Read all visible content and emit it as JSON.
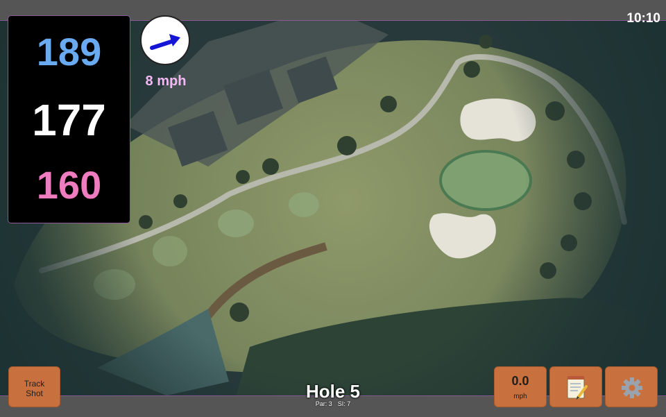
{
  "status_bar": {
    "time": "10:10"
  },
  "distances": {
    "back": "189",
    "middle": "177",
    "front": "160"
  },
  "colors": {
    "back": "#6aaaf0",
    "middle": "#ffffff",
    "front": "#f07cc0",
    "wind_text": "#f4b8f4",
    "button": "#c8713f",
    "wind_arrow": "#1515d6"
  },
  "wind": {
    "speed": "8 mph",
    "direction_icon": "arrow-icon"
  },
  "hole": {
    "title": "Hole 5",
    "par": "Par: 3",
    "si": "SI: 7"
  },
  "buttons": {
    "track_shot_line1": "Track",
    "track_shot_line2": "Shot",
    "speed_value": "0.0",
    "speed_unit": "mph",
    "notes_icon": "notepad-icon",
    "settings_icon": "gear-icon"
  }
}
